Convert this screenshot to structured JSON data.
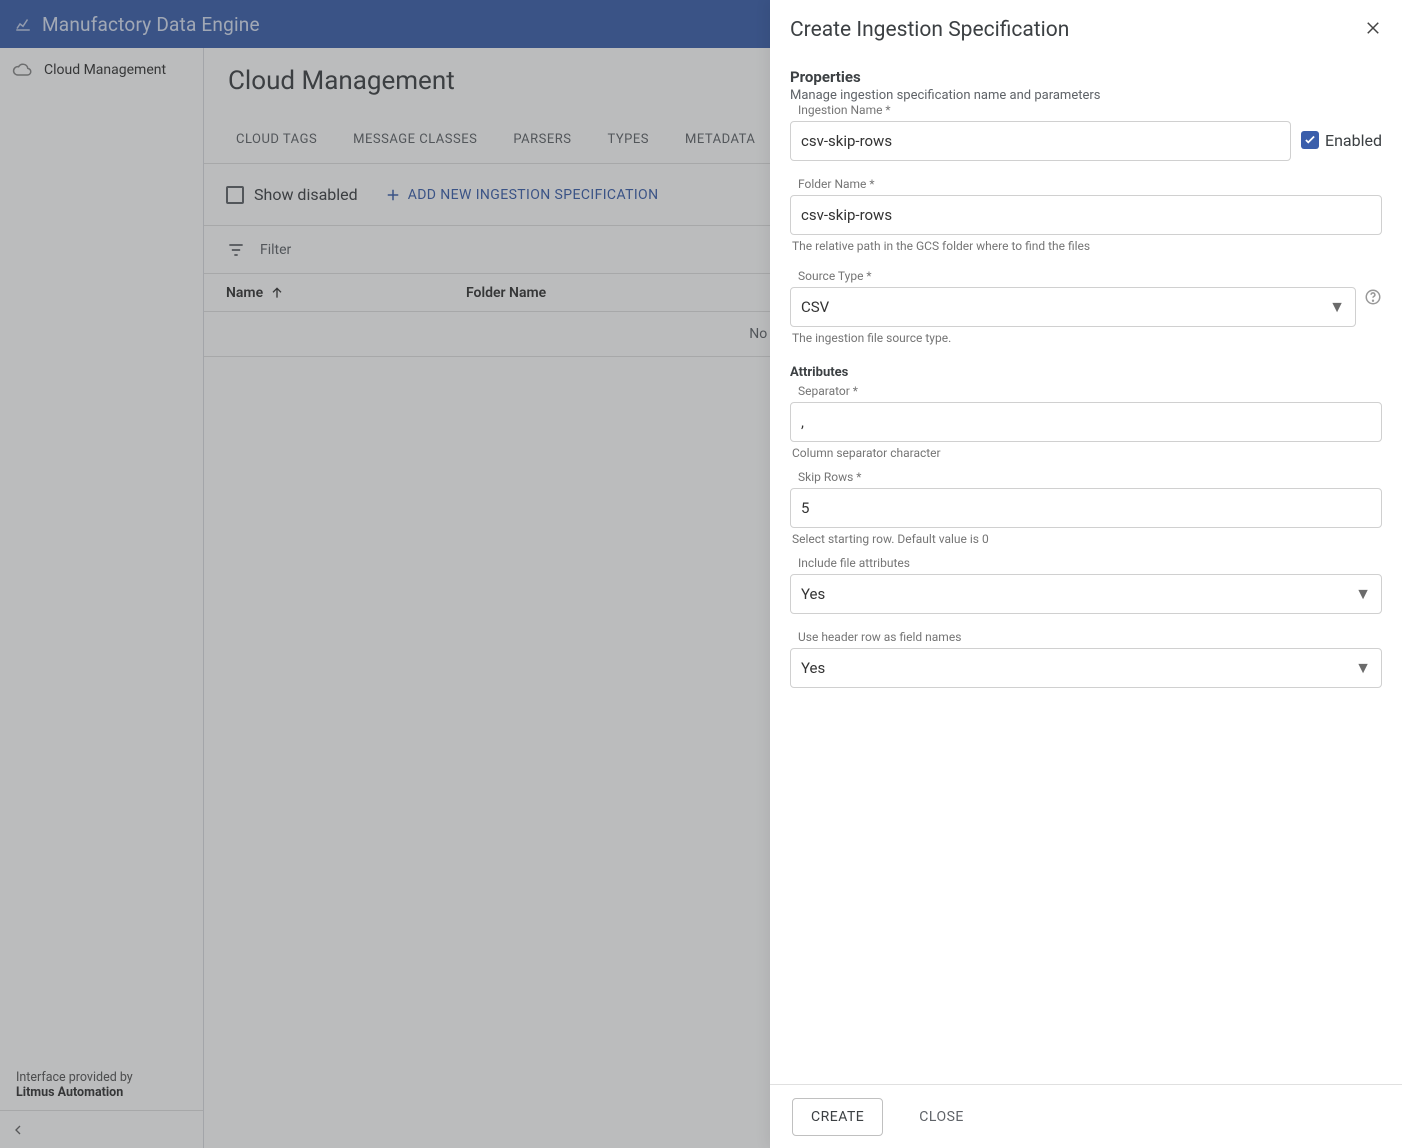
{
  "app": {
    "title": "Manufactory Data Engine"
  },
  "sidebar": {
    "items": [
      {
        "label": "Cloud Management"
      }
    ],
    "footer": {
      "line1": "Interface provided by",
      "brand": "Litmus Automation"
    }
  },
  "main": {
    "title": "Cloud Management",
    "tabs": [
      {
        "label": "CLOUD TAGS"
      },
      {
        "label": "MESSAGE CLASSES"
      },
      {
        "label": "PARSERS"
      },
      {
        "label": "TYPES"
      },
      {
        "label": "METADATA"
      }
    ],
    "toolbar": {
      "show_disabled_label": "Show disabled",
      "add_label": "ADD NEW INGESTION SPECIFICATION"
    },
    "filter_label": "Filter",
    "columns": {
      "name": "Name",
      "folder": "Folder Name"
    },
    "empty": "No available data"
  },
  "drawer": {
    "title": "Create Ingestion Specification",
    "properties": {
      "section": "Properties",
      "subtitle": "Manage ingestion specification name and parameters",
      "ingestion_name_label": "Ingestion Name *",
      "ingestion_name_value": "csv-skip-rows",
      "enabled_label": "Enabled",
      "folder_label": "Folder Name *",
      "folder_value": "csv-skip-rows",
      "folder_hint": "The relative path in the GCS folder where to find the files",
      "source_type_label": "Source Type *",
      "source_type_value": "CSV",
      "source_type_hint": "The ingestion file source type."
    },
    "attributes": {
      "section": "Attributes",
      "separator_label": "Separator *",
      "separator_value": ",",
      "separator_hint": "Column separator character",
      "skip_rows_label": "Skip Rows *",
      "skip_rows_value": "5",
      "skip_rows_hint": "Select starting row. Default value is 0",
      "include_attrs_label": "Include file attributes",
      "include_attrs_value": "Yes",
      "use_header_label": "Use header row as field names",
      "use_header_value": "Yes"
    },
    "buttons": {
      "create": "CREATE",
      "close": "CLOSE"
    }
  }
}
